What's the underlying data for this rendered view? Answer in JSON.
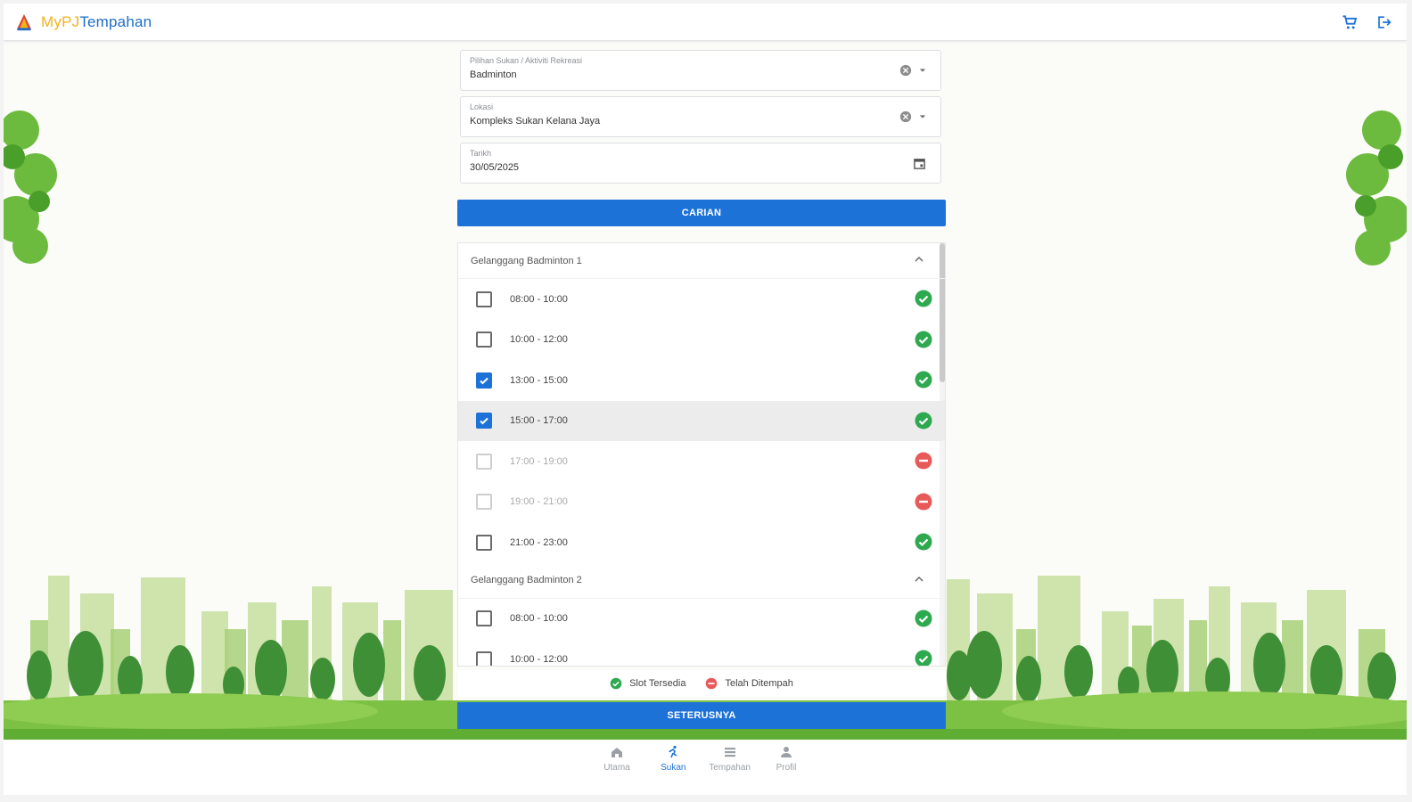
{
  "header": {
    "brand_part1": "My",
    "brand_part2": "PJ",
    "brand_part3": "Tempahan",
    "cart_icon": "cart-icon",
    "logout_icon": "logout-icon"
  },
  "form": {
    "sport": {
      "label": "Pilihan Sukan / Aktiviti Rekreasi",
      "value": "Badminton"
    },
    "location": {
      "label": "Lokasi",
      "value": "Kompleks Sukan Kelana Jaya"
    },
    "date": {
      "label": "Tarikh",
      "value": "30/05/2025"
    },
    "search_label": "CARIAN"
  },
  "courts": [
    {
      "name": "Gelanggang Badminton 1",
      "slots": [
        {
          "time": "08:00 - 10:00",
          "checked": false,
          "available": true
        },
        {
          "time": "10:00 - 12:00",
          "checked": false,
          "available": true
        },
        {
          "time": "13:00 - 15:00",
          "checked": true,
          "available": true
        },
        {
          "time": "15:00 - 17:00",
          "checked": true,
          "available": true
        },
        {
          "time": "17:00 - 19:00",
          "checked": false,
          "available": false
        },
        {
          "time": "19:00 - 21:00",
          "checked": false,
          "available": false
        },
        {
          "time": "21:00 - 23:00",
          "checked": false,
          "available": true
        }
      ]
    },
    {
      "name": "Gelanggang Badminton 2",
      "slots": [
        {
          "time": "08:00 - 10:00",
          "checked": false,
          "available": true
        },
        {
          "time": "10:00 - 12:00",
          "checked": false,
          "available": true
        }
      ]
    }
  ],
  "legend": {
    "available": "Slot Tersedia",
    "booked": "Telah Ditempah"
  },
  "next_label": "SETERUSNYA",
  "nav": {
    "home": "Utama",
    "sports": "Sukan",
    "bookings": "Tempahan",
    "profile": "Profil"
  },
  "colors": {
    "primary": "#1d72d8",
    "available": "#2ea94f",
    "booked": "#e85a5a",
    "brand_yellow": "#f2b21b"
  }
}
